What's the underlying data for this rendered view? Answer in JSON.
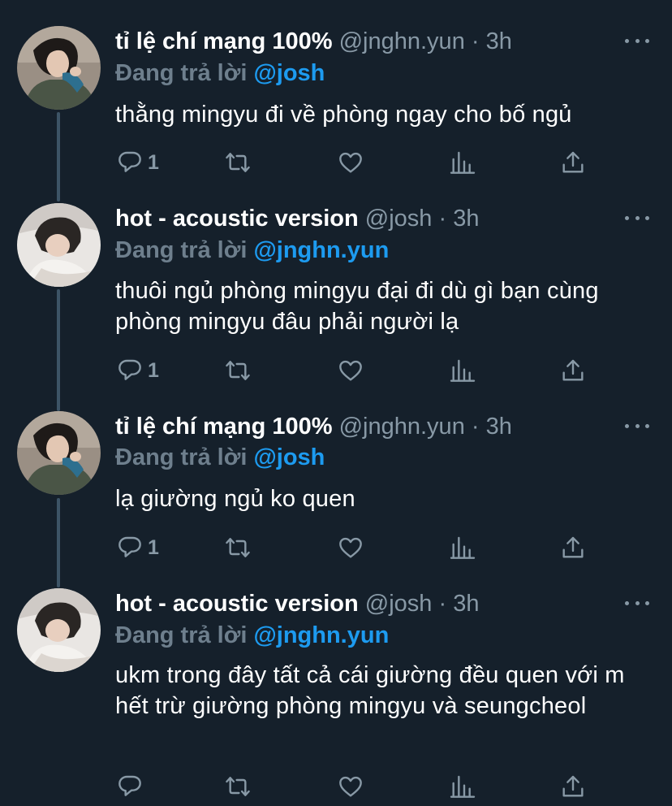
{
  "theme": {
    "background": "#15202b",
    "text": "#ffffff",
    "muted": "#8899a6",
    "mention": "#1d9bf0",
    "thread_line": "#3d5466"
  },
  "tweets": [
    {
      "display_name": "tỉ lệ chí mạng 100%",
      "handle": "@jnghn.yun",
      "separator": "·",
      "time": "3h",
      "replying_prefix": "Đang trả lời",
      "replying_to": "@josh",
      "text": "thằng mingyu đi về phòng ngay cho bố ngủ",
      "reply_count": "1",
      "avatar": "avatar-jnghn-yun"
    },
    {
      "display_name": "hot - acoustic version",
      "handle": "@josh",
      "separator": "·",
      "time": "3h",
      "replying_prefix": "Đang trả lời",
      "replying_to": "@jnghn.yun",
      "text": "thuôi ngủ phòng mingyu đại đi dù gì bạn cùng phòng mingyu đâu phải người lạ",
      "reply_count": "1",
      "avatar": "avatar-josh"
    },
    {
      "display_name": "tỉ lệ chí mạng 100%",
      "handle": "@jnghn.yun",
      "separator": "·",
      "time": "3h",
      "replying_prefix": "Đang trả lời",
      "replying_to": "@josh",
      "text": "lạ giường ngủ ko quen",
      "reply_count": "1",
      "avatar": "avatar-jnghn-yun"
    },
    {
      "display_name": "hot - acoustic version",
      "handle": "@josh",
      "separator": "·",
      "time": "3h",
      "replying_prefix": "Đang trả lời",
      "replying_to": "@jnghn.yun",
      "text": "ukm trong đây tất cả cái giường đều quen với m hết trừ giường phòng mingyu và seungcheol",
      "reply_count": "",
      "avatar": "avatar-josh"
    }
  ],
  "icons": {
    "reply": "reply-icon",
    "retweet": "retweet-icon",
    "like": "heart-icon",
    "analytics": "analytics-icon",
    "share": "share-icon",
    "more": "more-options-icon"
  }
}
